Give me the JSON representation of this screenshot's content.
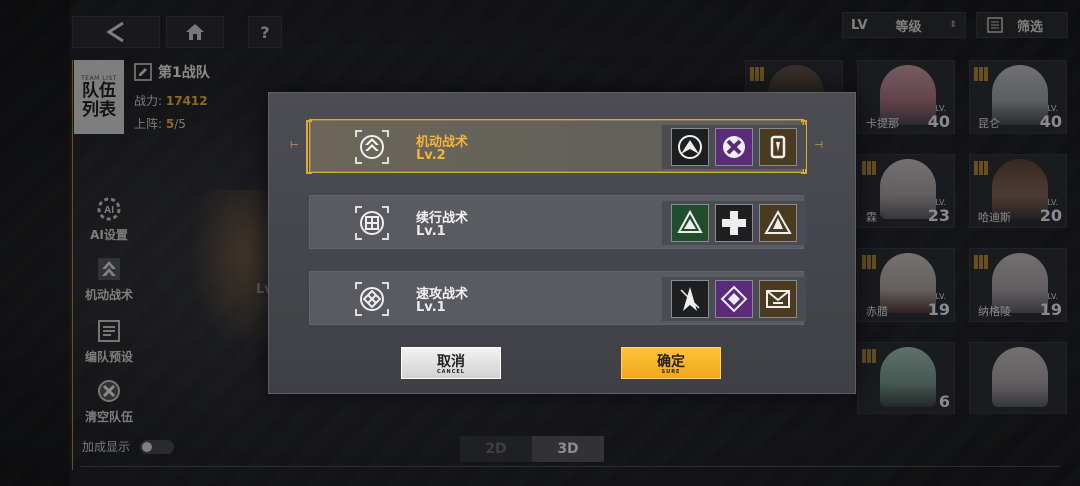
{
  "header": {
    "back_icon": "back-arrow-icon",
    "home_icon": "home-icon",
    "help_label": "?"
  },
  "filters": {
    "lv_label": "LV",
    "sort_label": "等级",
    "filter_label": "筛选"
  },
  "team": {
    "tab_small": "TEAM LIST",
    "tab_label": "队伍列表",
    "name": "第1战队",
    "power_label": "战力:",
    "power_value": "17412",
    "deploy_label": "上阵:",
    "deploy_value": "5",
    "deploy_max": "/5"
  },
  "sidebar": {
    "items": [
      {
        "label": "AI设置",
        "icon": "ai-settings-icon"
      },
      {
        "label": "机动战术",
        "icon": "tactic-icon"
      },
      {
        "label": "编队预设",
        "icon": "preset-icon"
      },
      {
        "label": "清空队伍",
        "icon": "clear-team-icon"
      }
    ],
    "bonus_label": "加成显示"
  },
  "background_fragment": "Lv",
  "view_switch": {
    "opt_2d": "2D",
    "opt_3d": "3D",
    "active": "3D"
  },
  "characters": [
    {
      "name": "",
      "level": ""
    },
    {
      "name": "卡提那",
      "level": "40"
    },
    {
      "name": "昆仑",
      "level": "40"
    },
    {
      "name": "霖",
      "level": "23"
    },
    {
      "name": "哈迪斯",
      "level": "20"
    },
    {
      "name": "赤腊",
      "level": "19"
    },
    {
      "name": "纳格陵",
      "level": "19"
    },
    {
      "name": "",
      "level": "6"
    }
  ],
  "dialog": {
    "tactics": [
      {
        "name": "机动战术",
        "level": "Lv.2",
        "selected": true,
        "slots": [
          "dark",
          "purple",
          "brown"
        ]
      },
      {
        "name": "续行战术",
        "level": "Lv.1",
        "selected": false,
        "slots": [
          "green",
          "dark",
          "brown"
        ]
      },
      {
        "name": "速攻战术",
        "level": "Lv.1",
        "selected": false,
        "slots": [
          "dark",
          "purple",
          "brown"
        ]
      }
    ],
    "cancel_label": "取消",
    "cancel_sub": "CANCEL",
    "confirm_label": "确定",
    "confirm_sub": "SURE",
    "accent_color": "#d9a93a"
  }
}
